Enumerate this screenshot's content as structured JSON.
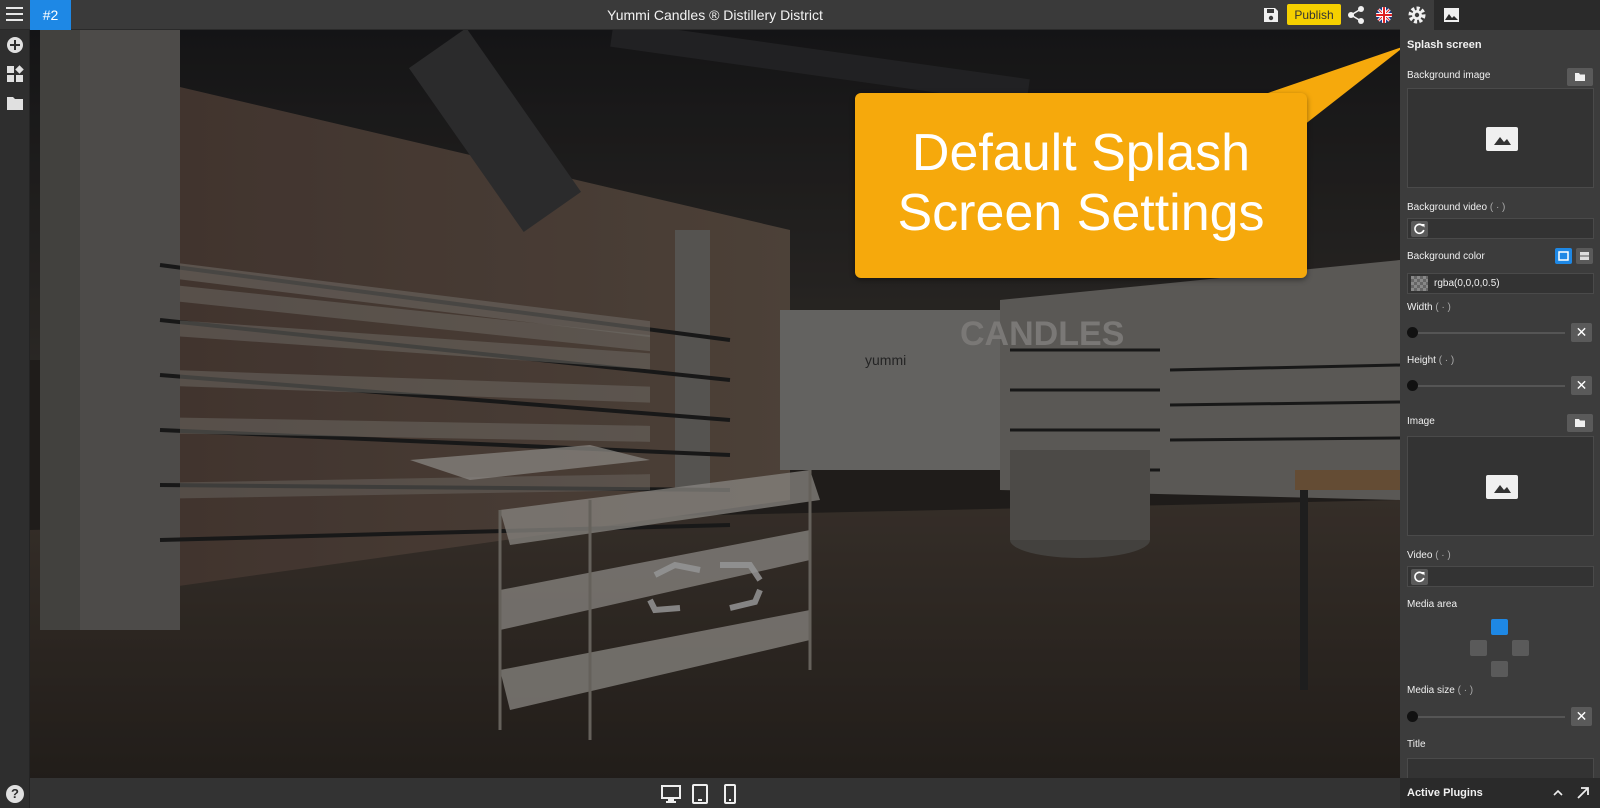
{
  "topbar": {
    "tour_number": "#2",
    "title": "Yummi Candles ® Distillery District",
    "publish_label": "Publish"
  },
  "callout": {
    "line1": "Default Splash",
    "line2": "Screen Settings",
    "color": "#f6a90c"
  },
  "panel": {
    "section_title": "Splash screen",
    "background_image_label": "Background image",
    "background_video_label": "Background video",
    "background_color_label": "Background color",
    "background_color_value": "rgba(0,0,0,0.5)",
    "width_label": "Width",
    "height_label": "Height",
    "image_label": "Image",
    "video_label": "Video",
    "media_area_label": "Media area",
    "media_size_label": "Media size",
    "title_label": "Title",
    "info_marker": "( · )"
  },
  "footer": {
    "active_plugins_label": "Active Plugins"
  },
  "viewer": {
    "scene": "Yummi Candles store interior panorama",
    "sign_candles": "CANDLES",
    "sign_brand": "yummi"
  },
  "accent_color": "#1e88e5"
}
